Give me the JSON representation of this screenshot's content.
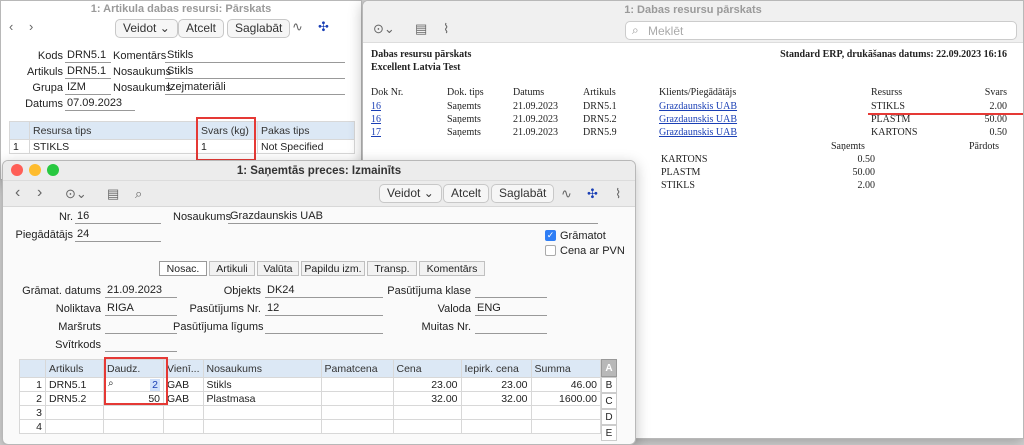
{
  "win_article": {
    "title": "1: Artikula dabas resursi: Pārskats",
    "create": "Veidot",
    "cancel": "Atcelt",
    "save": "Saglabāt",
    "code_label": "Kods",
    "code": "DRN5.1",
    "comment_label": "Komentārs",
    "comment": "Stikls",
    "article_label": "Artikuls",
    "article": "DRN5.1",
    "name_label": "Nosaukums",
    "name": "Stikls",
    "group_label": "Grupa",
    "group": "IZM",
    "name2_label": "Nosaukums",
    "name2": "Izejmateriāli",
    "date_label": "Datums",
    "date": "07.09.2023",
    "grid_headers": [
      "Resursa tips",
      "Svars (kg)",
      "Pakas tips"
    ],
    "grid_row": {
      "n": "1",
      "type": "STIKLS",
      "weight": "1",
      "pack": "Not Specified"
    }
  },
  "win_report": {
    "title": "1: Dabas resursu pārskats",
    "search_placeholder": "Meklēt",
    "heading1": "Dabas resursu pārskats",
    "heading2": "Excellent Latvia Test",
    "meta": "Standard ERP, drukāšanas datums: 22.09.2023 16:16",
    "headers": [
      "Dok Nr.",
      "Dok. tips",
      "Datums",
      "Artikuls",
      "Klients/Piegādātājs",
      "Resurss",
      "Svars"
    ],
    "rows": [
      {
        "doc": "16",
        "type": "Saņemts",
        "date": "21.09.2023",
        "art": "DRN5.1",
        "client": "Grazdaunskis UAB",
        "res": "STIKLS",
        "weight": "2.00"
      },
      {
        "doc": "16",
        "type": "Saņemts",
        "date": "21.09.2023",
        "art": "DRN5.2",
        "client": "Grazdaunskis UAB",
        "res": "PLASTM",
        "weight": "50.00"
      },
      {
        "doc": "17",
        "type": "Saņemts",
        "date": "21.09.2023",
        "art": "DRN5.9",
        "client": "Grazdaunskis UAB",
        "res": "KARTONS",
        "weight": "0.50"
      }
    ],
    "summary_headers": [
      "Saņemts",
      "Pārdots"
    ],
    "summary": [
      {
        "res": "KARTONS",
        "val": "0.50"
      },
      {
        "res": "PLASTM",
        "val": "50.00"
      },
      {
        "res": "STIKLS",
        "val": "2.00"
      }
    ]
  },
  "win_receipt": {
    "title": "1: Saņemtās preces: Izmainīts",
    "create": "Veidot",
    "cancel": "Atcelt",
    "save": "Saglabāt",
    "nr_label": "Nr.",
    "nr": "16",
    "name_label": "Nosaukums",
    "name": "Grazdaunskis UAB",
    "supplier_label": "Piegādātājs",
    "supplier": "24",
    "booked_label": "Grāmatot",
    "price_vat_label": "Cena ar PVN",
    "tabs": [
      "Nosac.",
      "Artikuli",
      "Valūta",
      "Papildu izm.",
      "Transp.",
      "Komentārs"
    ],
    "book_date_label": "Grāmat. datums",
    "book_date": "21.09.2023",
    "object_label": "Objekts",
    "object": "DK24",
    "order_class_label": "Pasūtījuma klase",
    "order_class": "",
    "warehouse_label": "Noliktava",
    "warehouse": "RIGA",
    "order_nr_label": "Pasūtījums Nr.",
    "order_nr": "12",
    "language_label": "Valoda",
    "language": "ENG",
    "route_label": "Maršruts",
    "route": "",
    "contract_label": "Pasūtījuma līgums",
    "contract": "",
    "customs_label": "Muitas Nr.",
    "customs": "",
    "barcode_label": "Svītrkods",
    "barcode": "",
    "grid_headers": [
      "Artikuls",
      "Daudz.",
      "Vienī...",
      "Nosaukums",
      "Pamatcena",
      "Cena",
      "Iepirk. cena",
      "Summa"
    ],
    "grid_rows": [
      {
        "n": "1",
        "art": "DRN5.1",
        "qty": "2",
        "unit": "GAB",
        "name": "Stikls",
        "base": "",
        "price": "23.00",
        "cost": "23.00",
        "sum": "46.00"
      },
      {
        "n": "2",
        "art": "DRN5.2",
        "qty": "50",
        "unit": "GAB",
        "name": "Plastmasa",
        "base": "",
        "price": "32.00",
        "cost": "32.00",
        "sum": "1600.00"
      },
      {
        "n": "3",
        "art": "",
        "qty": "",
        "unit": "",
        "name": "",
        "base": "",
        "price": "",
        "cost": "",
        "sum": ""
      },
      {
        "n": "4",
        "art": "",
        "qty": "",
        "unit": "",
        "name": "",
        "base": "",
        "price": "",
        "cost": "",
        "sum": ""
      }
    ],
    "side_letters": [
      "A",
      "B",
      "C",
      "D",
      "E"
    ]
  },
  "colors": {
    "accent": "#1a3fb5",
    "highlight": "#e53935",
    "grid_header": "#dce8f5"
  }
}
